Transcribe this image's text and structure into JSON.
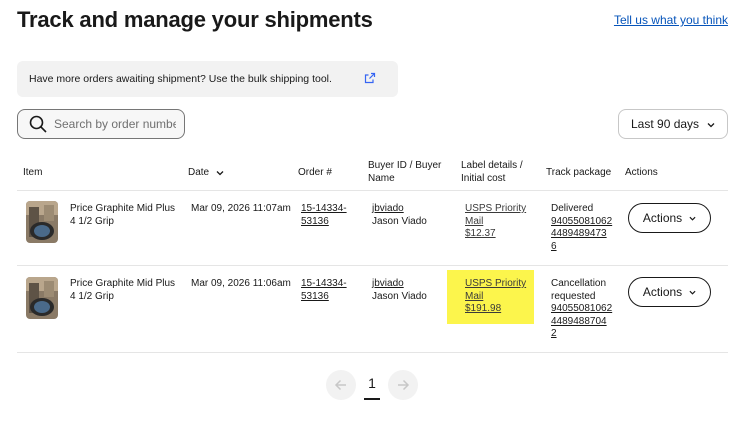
{
  "header": {
    "title": "Track and manage your shipments",
    "feedback_link": "Tell us what you think"
  },
  "banner": {
    "text": "Have more orders awaiting shipment? Use the bulk shipping tool.",
    "icon": "external-link-icon"
  },
  "search": {
    "placeholder": "Search by order number",
    "value": ""
  },
  "date_filter": {
    "selected": "Last 90 days"
  },
  "table": {
    "headers": {
      "item": "Item",
      "date": "Date",
      "order": "Order #",
      "buyer_line1": "Buyer ID / Buyer",
      "buyer_line2": "Name",
      "label_line1": "Label details /",
      "label_line2": "Initial cost",
      "track": "Track package",
      "actions": "Actions"
    },
    "rows": [
      {
        "title_line1": "Price Graphite Mid Plus",
        "title_line2": "4 1/2 Grip",
        "date": "Mar 09, 2026 11:07am",
        "order_line1": "15-14334-",
        "order_line2": "53136",
        "buyer_id": "jbviado",
        "buyer_name": "Jason Viado",
        "label_line1": "USPS Priority",
        "label_line2": "Mail",
        "cost": "$12.37",
        "status": "Delivered",
        "tracking_line1": "94055081062",
        "tracking_line2": "4489489473",
        "tracking_line3": "6",
        "actions_label": "Actions"
      },
      {
        "title_line1": "Price Graphite Mid Plus",
        "title_line2": "4 1/2 Grip",
        "date": "Mar 09, 2026 11:06am",
        "order_line1": "15-14334-",
        "order_line2": "53136",
        "buyer_id": "jbviado",
        "buyer_name": "Jason Viado",
        "label_line1": "USPS Priority",
        "label_line2": "Mail",
        "cost": "$191.98",
        "status_line1": "Cancellation",
        "status_line2": "requested",
        "tracking_line1": "94055081062",
        "tracking_line2": "4489488704",
        "tracking_line3": "2",
        "actions_label": "Actions"
      }
    ]
  },
  "pagination": {
    "current_page": "1"
  },
  "colors": {
    "link_blue": "#0654ba",
    "highlight_yellow": "#fcf54c",
    "banner_bg": "#f2f2f2"
  }
}
